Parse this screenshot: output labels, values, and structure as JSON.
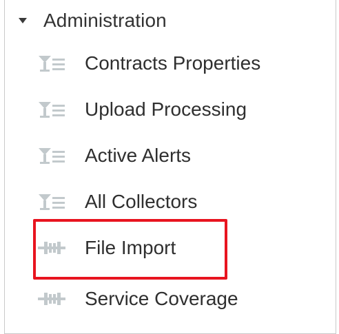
{
  "tree": {
    "section": {
      "title": "Administration",
      "expanded": true
    },
    "items": [
      {
        "label": "Contracts Properties",
        "icon": "report-list-icon"
      },
      {
        "label": "Upload Processing",
        "icon": "report-list-icon"
      },
      {
        "label": "Active Alerts",
        "icon": "report-list-icon"
      },
      {
        "label": "All Collectors",
        "icon": "report-list-icon"
      },
      {
        "label": "File Import",
        "icon": "plugin-connector-icon"
      },
      {
        "label": "Service Coverage",
        "icon": "plugin-connector-icon"
      }
    ]
  },
  "colors": {
    "highlight": "#e8141f",
    "icon": "#c2c9cc",
    "text": "#333333"
  }
}
